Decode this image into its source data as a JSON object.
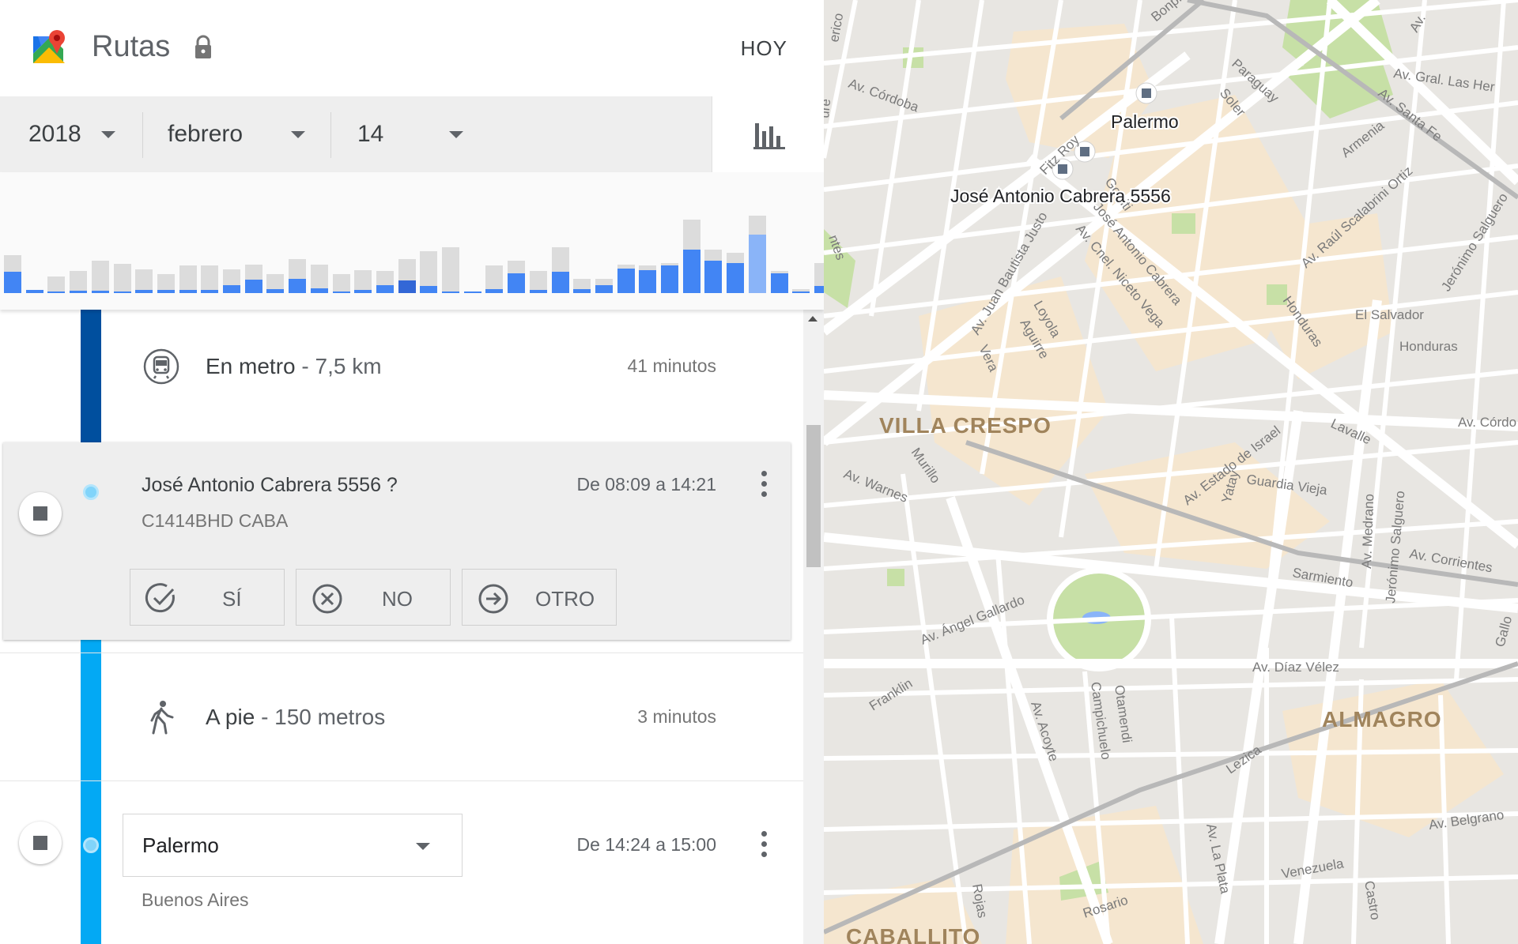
{
  "header": {
    "title": "Rutas",
    "today_label": "HOY"
  },
  "date": {
    "year": "2018",
    "month": "febrero",
    "day": "14"
  },
  "histogram": {
    "totals": [
      0.48,
      0.04,
      0.21,
      0.28,
      0.41,
      0.37,
      0.3,
      0.24,
      0.35,
      0.35,
      0.3,
      0.36,
      0.24,
      0.43,
      0.36,
      0.24,
      0.29,
      0.28,
      0.43,
      0.53,
      0.58,
      0.02,
      0.35,
      0.41,
      0.28,
      0.58,
      0.18,
      0.18,
      0.36,
      0.35,
      0.38,
      0.93,
      0.55,
      0.51,
      0.98,
      0.28,
      0.05,
      0.38
    ],
    "actives": [
      0.27,
      0.04,
      0.02,
      0.03,
      0.03,
      0.02,
      0.04,
      0.04,
      0.04,
      0.04,
      0.1,
      0.17,
      0.05,
      0.18,
      0.06,
      0.02,
      0.04,
      0.1,
      0.16,
      0.09,
      0.02,
      0.02,
      0.05,
      0.25,
      0.04,
      0.27,
      0.05,
      0.1,
      0.31,
      0.29,
      0.35,
      0.55,
      0.41,
      0.38,
      0.74,
      0.25,
      0.02,
      0.09
    ],
    "colors": {
      "total": "#dcdcdc",
      "active": "#4285f4",
      "active_dark": "#3367d6",
      "active_light": "#8ab4f8"
    }
  },
  "timeline": {
    "segments": [
      {
        "mode_label": "En metro",
        "distance": "- 7,5 km",
        "duration": "41 minutos",
        "icon": "subway-icon"
      },
      {
        "mode_label": "A pie",
        "distance": "- 150 metros",
        "duration": "3 minutos",
        "icon": "walk-icon"
      }
    ],
    "visit1": {
      "title": "José Antonio Cabrera 5556 ?",
      "subtitle": "C1414BHD CABA",
      "time": "De 08:09 a 14:21",
      "buttons": {
        "yes": "SÍ",
        "no": "NO",
        "other": "OTRO"
      }
    },
    "visit2": {
      "selected_place": "Palermo",
      "subtitle": "Buenos Aires",
      "time": "De 14:24 a 15:00"
    },
    "line_colors": {
      "transit": "#004f9e",
      "walk": "#03a9f4"
    }
  },
  "map": {
    "labels": {
      "palermo_marker": "Palermo",
      "cabrera_marker": "José Antonio Cabrera 5556",
      "villa_crespo": "VILLA CRESPO",
      "almagro": "ALMAGRO",
      "caballito": "CABALLITO",
      "el_salvador": "El Salvador",
      "honduras": "Honduras",
      "honduras2": "Honduras",
      "lavalle": "Lavalle",
      "av_cordoba": "Av. Córdoba",
      "av_cordoba2": "Av. Córdo",
      "av_gral_las_heras": "Av. Gral. Las Her",
      "av_santa_fe": "Av. Santa Fe",
      "armenia": "Armenia",
      "soler": "Soler",
      "paraguay": "Paraguay",
      "fitz_roy": "Fitz Roy",
      "gorriti": "Gorriti",
      "jose_antonio_cabrera": "José Antonio Cabrera",
      "av_juan_b_justo": "Av. Juan Bautista Justo",
      "av_cnel_niceto_vega": "Av. Cnel. Niceto Vega",
      "av_raul_scalabrini_ortiz": "Av. Raúl Scalabrini Ortiz",
      "jeronimo_salguero": "Jerónimo Salguero",
      "loyola": "Loyola",
      "aguirre": "Aguirre",
      "vera": "Vera",
      "murillo": "Murillo",
      "av_warnes": "Av. Warnes",
      "av_estado_de_israel": "Av. Estado de Israel",
      "yatay": "Yatay",
      "guardia_vieja": "Guardia Vieja",
      "av_medrano": "Av. Medrano",
      "jeronimo_salguero2": "Jerónimo Salguero",
      "av_corrientes": "Av. Corrientes",
      "sarmiento": "Sarmiento",
      "av_angel_gallardo": "Av. Ángel Gallardo",
      "franklin": "Franklin",
      "av_acoyte": "Av. Acoyte",
      "campichuelo": "Campichuelo",
      "otamendi": "Otamendi",
      "av_diaz_velez": "Av. Díaz Vélez",
      "lezica": "Lezica",
      "av_la_plata": "Av. La Plata",
      "venezuela": "Venezuela",
      "rosario": "Rosario",
      "rojas": "Rojas",
      "castro": "Castro",
      "av_belgrano": "Av. Belgrano",
      "gallo": "Gallo",
      "bonpland": "Bonpl",
      "av": "Av.",
      "ure": "ure",
      "ntes": "ntes",
      "erico": "erico"
    }
  }
}
